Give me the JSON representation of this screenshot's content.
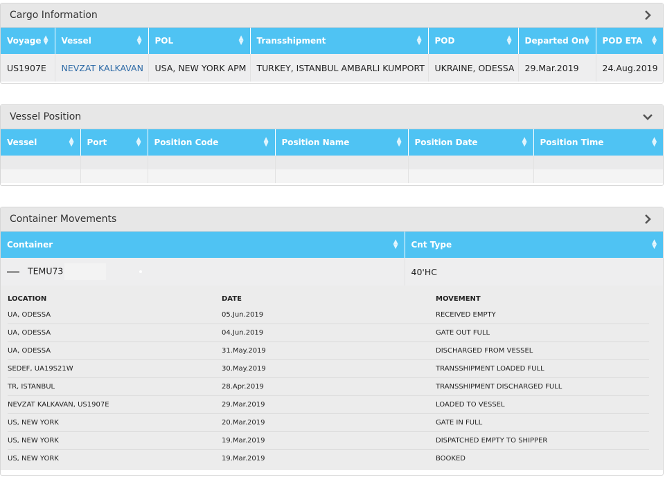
{
  "cargo": {
    "title": "Cargo Information",
    "headers": [
      "Voyage",
      "Vessel",
      "POL",
      "Transshipment",
      "POD",
      "Departed On",
      "POD ETA"
    ],
    "row": {
      "voyage": "US1907E",
      "vessel": "NEVZAT KALKAVAN",
      "pol": "USA, NEW YORK APM",
      "transshipment": "TURKEY, ISTANBUL AMBARLI KUMPORT",
      "pod": "UKRAINE, ODESSA",
      "departed": "29.Mar.2019",
      "eta": "24.Aug.2019"
    },
    "toggle_icon": "chevron-right-icon"
  },
  "vessel_position": {
    "title": "Vessel Position",
    "headers": [
      "Vessel",
      "Port",
      "Position Code",
      "Position Name",
      "Position Date",
      "Position Time"
    ],
    "toggle_icon": "chevron-down-icon"
  },
  "containers": {
    "title": "Container Movements",
    "headers": [
      "Container",
      "Cnt Type"
    ],
    "container_no": "TEMU73",
    "cnt_type": "40'HC",
    "toggle_icon": "chevron-right-icon",
    "movement_headers": [
      "LOCATION",
      "DATE",
      "MOVEMENT"
    ],
    "movements": [
      {
        "location": "UA, ODESSA",
        "date": "05.Jun.2019",
        "movement": "RECEIVED EMPTY"
      },
      {
        "location": "UA, ODESSA",
        "date": "04.Jun.2019",
        "movement": "GATE OUT FULL"
      },
      {
        "location": "UA, ODESSA",
        "date": "31.May.2019",
        "movement": "DISCHARGED FROM VESSEL"
      },
      {
        "location": "SEDEF, UA19S21W",
        "date": "30.May.2019",
        "movement": "TRANSSHIPMENT LOADED FULL"
      },
      {
        "location": "TR, ISTANBUL",
        "date": "28.Apr.2019",
        "movement": "TRANSSHIPMENT DISCHARGED FULL"
      },
      {
        "location": "NEVZAT KALKAVAN, US1907E",
        "date": "29.Mar.2019",
        "movement": "LOADED TO VESSEL"
      },
      {
        "location": "US, NEW YORK",
        "date": "20.Mar.2019",
        "movement": "GATE IN FULL"
      },
      {
        "location": "US, NEW YORK",
        "date": "19.Mar.2019",
        "movement": "DISPATCHED EMPTY TO SHIPPER"
      },
      {
        "location": "US, NEW YORK",
        "date": "19.Mar.2019",
        "movement": "BOOKED"
      }
    ]
  },
  "colors": {
    "header_blue": "#4fc3f3",
    "link_blue": "#2d6aa6",
    "panel_head": "#e7e7e7"
  }
}
